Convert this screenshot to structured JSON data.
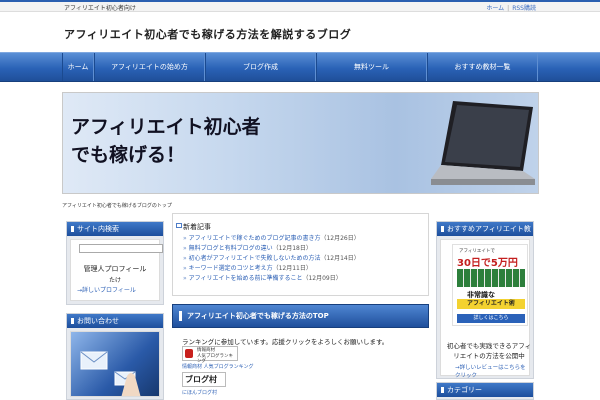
{
  "topbar": {
    "tagline": "アフィリエイト初心者向け",
    "links": [
      "ホーム",
      "RSS購読"
    ]
  },
  "header": {
    "site_title": "アフィリエイト初心者でも稼げる方法を解説するブログ"
  },
  "nav": {
    "items": [
      "ホーム",
      "アフィリエイトの始め方",
      "ブログ作成",
      "無料ツール",
      "おすすめ教材一覧"
    ]
  },
  "hero": {
    "line1": "アフィリエイト初心者",
    "line2": "でも稼げる！"
  },
  "breadcrumb": "アフィリエイト初心者でも稼げるブログのトップ",
  "sidebar_left": {
    "panel1": {
      "title": "サイト内検索",
      "member_title": "管理人プロフィール",
      "member_name": "たけ",
      "member_link": "詳しいプロフィール"
    },
    "panel2": {
      "title": "お問い合わせ"
    }
  },
  "news": {
    "title": "新着記事",
    "items": [
      {
        "text": "アフィリエイトで稼ぐためのブログ記事の書き方",
        "date": "（12月26日）"
      },
      {
        "text": "無料ブログと有料ブログの違い",
        "date": "（12月18日）"
      },
      {
        "text": "初心者がアフィリエイトで失敗しないための方法",
        "date": "（12月14日）"
      },
      {
        "text": "キーワード選定のコツと考え方",
        "date": "（12月11日）"
      },
      {
        "text": "アフィリエイトを始める前に準備すること",
        "date": "（12月09日）"
      }
    ]
  },
  "main": {
    "heading": "アフィリエイト初心者でも稼げる方法のTOP",
    "intro": "ランキングに参加しています。応援クリックをよろしくお願いします。",
    "rank1_line1": "情報商材",
    "rank1_line2": "人気ブログランキング",
    "rank1_link": "情報商材 人気ブログランキング",
    "rank2_text": "ブログ村",
    "rank2_link": "にほんブログ村"
  },
  "sidebar_right": {
    "panel1": {
      "title": "おすすめアフィリエイト教材",
      "ad_line1": "アフィリエイトで",
      "ad_line2": "30日で5万円",
      "ad_line3": "非常識な",
      "ad_line4": "アフィリエイト術",
      "ad_button": "詳しくはこちら",
      "desc": "初心者でも実践できるアフィリエイトの方法を公開中",
      "more_link": "詳しいレビューはこちらをクリック"
    },
    "panel2": {
      "title": "カテゴリー"
    }
  }
}
